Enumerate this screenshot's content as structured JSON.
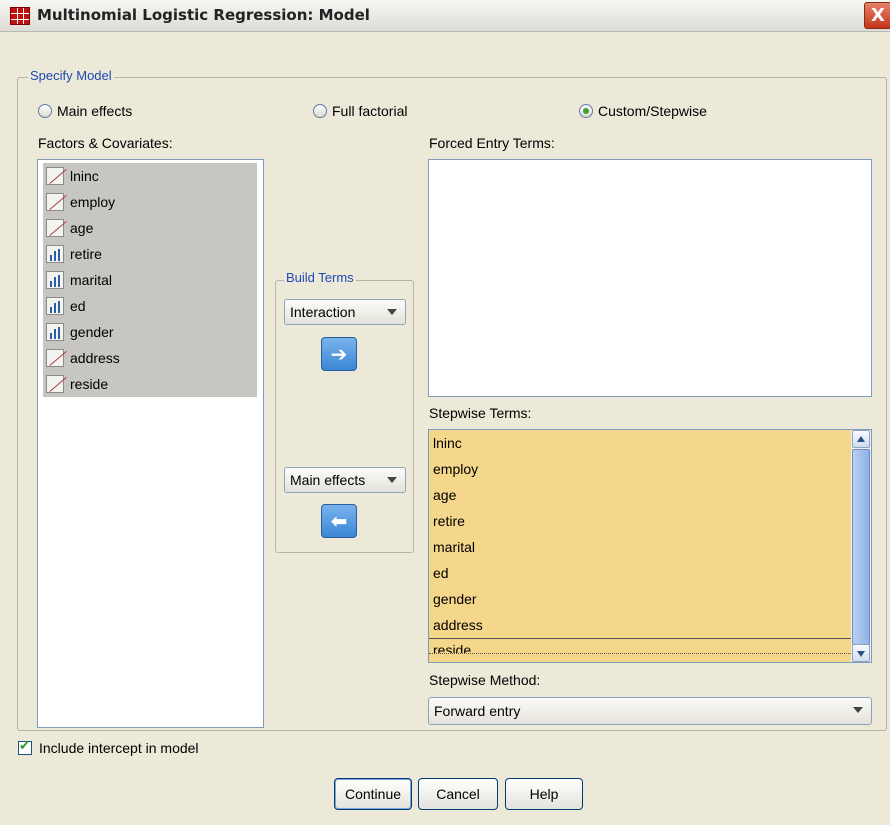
{
  "window": {
    "title": "Multinomial Logistic Regression: Model",
    "close_label": "X"
  },
  "specify_model": {
    "legend": "Specify Model",
    "options": [
      {
        "label": "Main effects",
        "selected": false
      },
      {
        "label": "Full factorial",
        "selected": false
      },
      {
        "label": "Custom/Stepwise",
        "selected": true
      }
    ]
  },
  "factors": {
    "label": "Factors & Covariates:",
    "items": [
      {
        "name": "lninc",
        "icon": "scale-icon"
      },
      {
        "name": "employ",
        "icon": "scale-icon"
      },
      {
        "name": "age",
        "icon": "scale-icon"
      },
      {
        "name": "retire",
        "icon": "nominal-icon"
      },
      {
        "name": "marital",
        "icon": "nominal-icon"
      },
      {
        "name": "ed",
        "icon": "nominal-icon"
      },
      {
        "name": "gender",
        "icon": "nominal-icon"
      },
      {
        "name": "address",
        "icon": "scale-icon"
      },
      {
        "name": "reside",
        "icon": "scale-icon"
      }
    ]
  },
  "build_terms": {
    "legend": "Build Terms",
    "forced_type": "Interaction",
    "stepwise_type": "Main effects",
    "move_right_icon": "right-arrow-icon",
    "move_left_icon": "left-arrow-icon",
    "right_arrow_glyph": "➔",
    "left_arrow_glyph": "⬅"
  },
  "forced_entry": {
    "label": "Forced Entry Terms:",
    "items": []
  },
  "stepwise_terms": {
    "label": "Stepwise Terms:",
    "items": [
      "lninc",
      "employ",
      "age",
      "retire",
      "marital",
      "ed",
      "gender",
      "address",
      "reside"
    ]
  },
  "stepwise_method": {
    "label": "Stepwise Method:",
    "value": "Forward entry"
  },
  "include_intercept": {
    "label": "Include intercept in model",
    "checked": true
  },
  "buttons": {
    "continue": "Continue",
    "cancel": "Cancel",
    "help": "Help"
  },
  "colors": {
    "stepwise_bg": "#f5d78b",
    "selection_gray": "#c7c6c3",
    "dialog_bg": "#ece9d8"
  }
}
